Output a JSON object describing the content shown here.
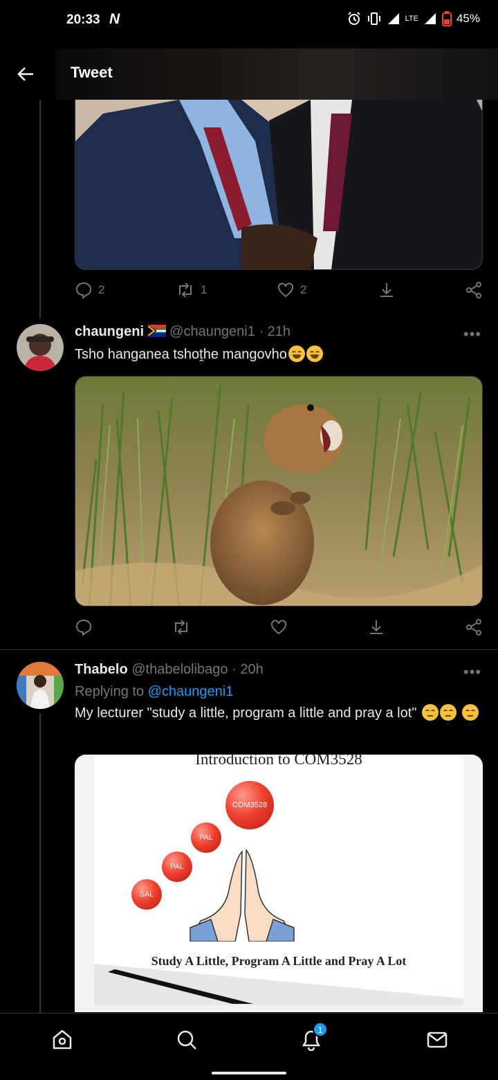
{
  "status_bar": {
    "time": "20:33",
    "brand_glyph": "N",
    "network": "LTE",
    "battery": "45%"
  },
  "header": {
    "title": "Tweet"
  },
  "tweet0": {
    "reply_count": "2",
    "retweet_count": "1",
    "like_count": "2"
  },
  "tweet1": {
    "name": "chaungeni",
    "handle": "@chaungeni1",
    "separator": "·",
    "time": "21h",
    "text": "Tsho hanganea tshoṱhe mangovho",
    "more": "•••"
  },
  "tweet2": {
    "name": "Thabelo",
    "handle": "@thabelolibago",
    "separator": "·",
    "time": "20h",
    "replying_prefix": "Replying to",
    "replying_handle": "@chaungeni1",
    "text": "My lecturer \"study a little, program a little and pray a lot\"",
    "more": "•••",
    "slide": {
      "title": "Introduction to COM3528",
      "bubbles": [
        "COM3528",
        "PAL",
        "PAL",
        "SAL"
      ],
      "caption": "Study A Little, Program A Little and Pray A Lot"
    }
  },
  "bottom_nav": {
    "notification_badge": "1"
  },
  "icons": [
    "back-arrow-icon",
    "reply-icon",
    "retweet-icon",
    "like-icon",
    "download-icon",
    "share-icon",
    "home-icon",
    "search-icon",
    "notification-bell-icon",
    "messages-icon",
    "alarm-icon",
    "vibrate-icon",
    "signal-icon",
    "battery-icon",
    "flag-icon"
  ],
  "colors": {
    "background": "#000000",
    "text": "#e7e9ea",
    "muted": "#71767b",
    "accent": "#1d9bf0",
    "divider": "#2f3336"
  }
}
